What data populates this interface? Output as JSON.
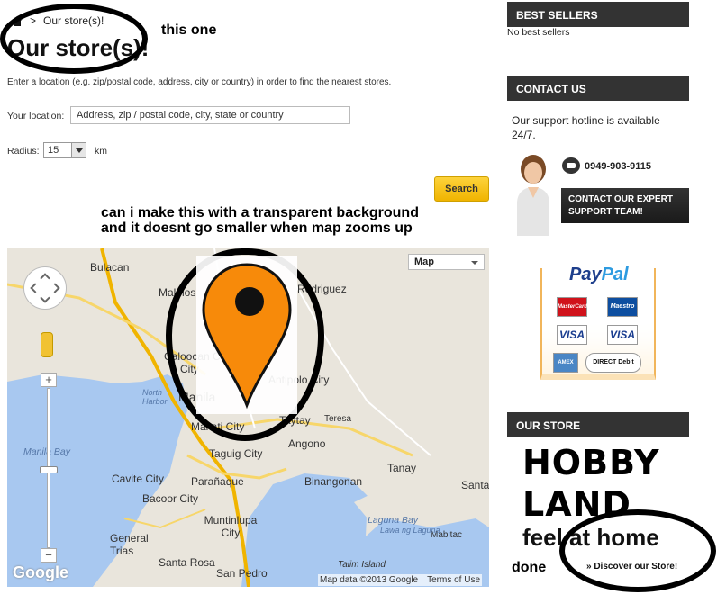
{
  "breadcrumb": {
    "current": "Our store(s)!",
    "separator": ">"
  },
  "page_title": "Our store(s)!",
  "annotations": {
    "this_one": "this one",
    "question_line1": "can i make this with a transparent background",
    "question_line2": "and it doesnt go smaller when map zooms up",
    "done": "done"
  },
  "intro_text": "Enter a location (e.g. zip/postal code, address, city or country) in order to find the nearest stores.",
  "location": {
    "label": "Your location:",
    "placeholder": "Address, zip / postal code, city, state or country"
  },
  "radius": {
    "label": "Radius:",
    "value": "15",
    "unit": "km"
  },
  "search_button": "Search",
  "map": {
    "type_selector": "Map",
    "labels": [
      "Bulacan",
      "Malolos",
      "Rodriguez",
      "Caloocan City",
      "City",
      "Manila",
      "Antipolo City",
      "Makati City",
      "Taytay",
      "Teresa",
      "Taguig City",
      "Angono",
      "Cavite City",
      "Parañaque",
      "Binangonan",
      "Tanay",
      "Bacoor City",
      "Muntinlupa City",
      "General Trias",
      "Santa Rosa",
      "San Pedro",
      "Santa",
      "Mabitac",
      "Talim Island"
    ],
    "water_labels": [
      "Manila Bay",
      "North Harbor",
      "Laguna Bay",
      "Lawa ng Laguna"
    ],
    "logo": "Google",
    "footer_data": "Map data ©2013 Google",
    "footer_terms": "Terms of Use"
  },
  "sidebar": {
    "best_sellers": {
      "title": "BEST SELLERS",
      "text": "No best sellers"
    },
    "contact": {
      "title": "CONTACT US",
      "hotline_text": "Our support hotline is available 24/7.",
      "phone": "0949-903-9115",
      "expert_line1": "CONTACT OUR EXPERT",
      "expert_line2": "SUPPORT TEAM!"
    },
    "paypal": {
      "brand_left": "Pay",
      "brand_right": "Pal",
      "cards": [
        "MasterCard",
        "Maestro",
        "VISA",
        "VISA",
        "AMEX",
        "DIRECT Debit"
      ]
    },
    "store": {
      "title": "OUR STORE",
      "logo_line1": "HOBBY",
      "logo_line2": "LAND",
      "tagline": "feel at home",
      "discover_link": "» Discover our Store!"
    }
  }
}
